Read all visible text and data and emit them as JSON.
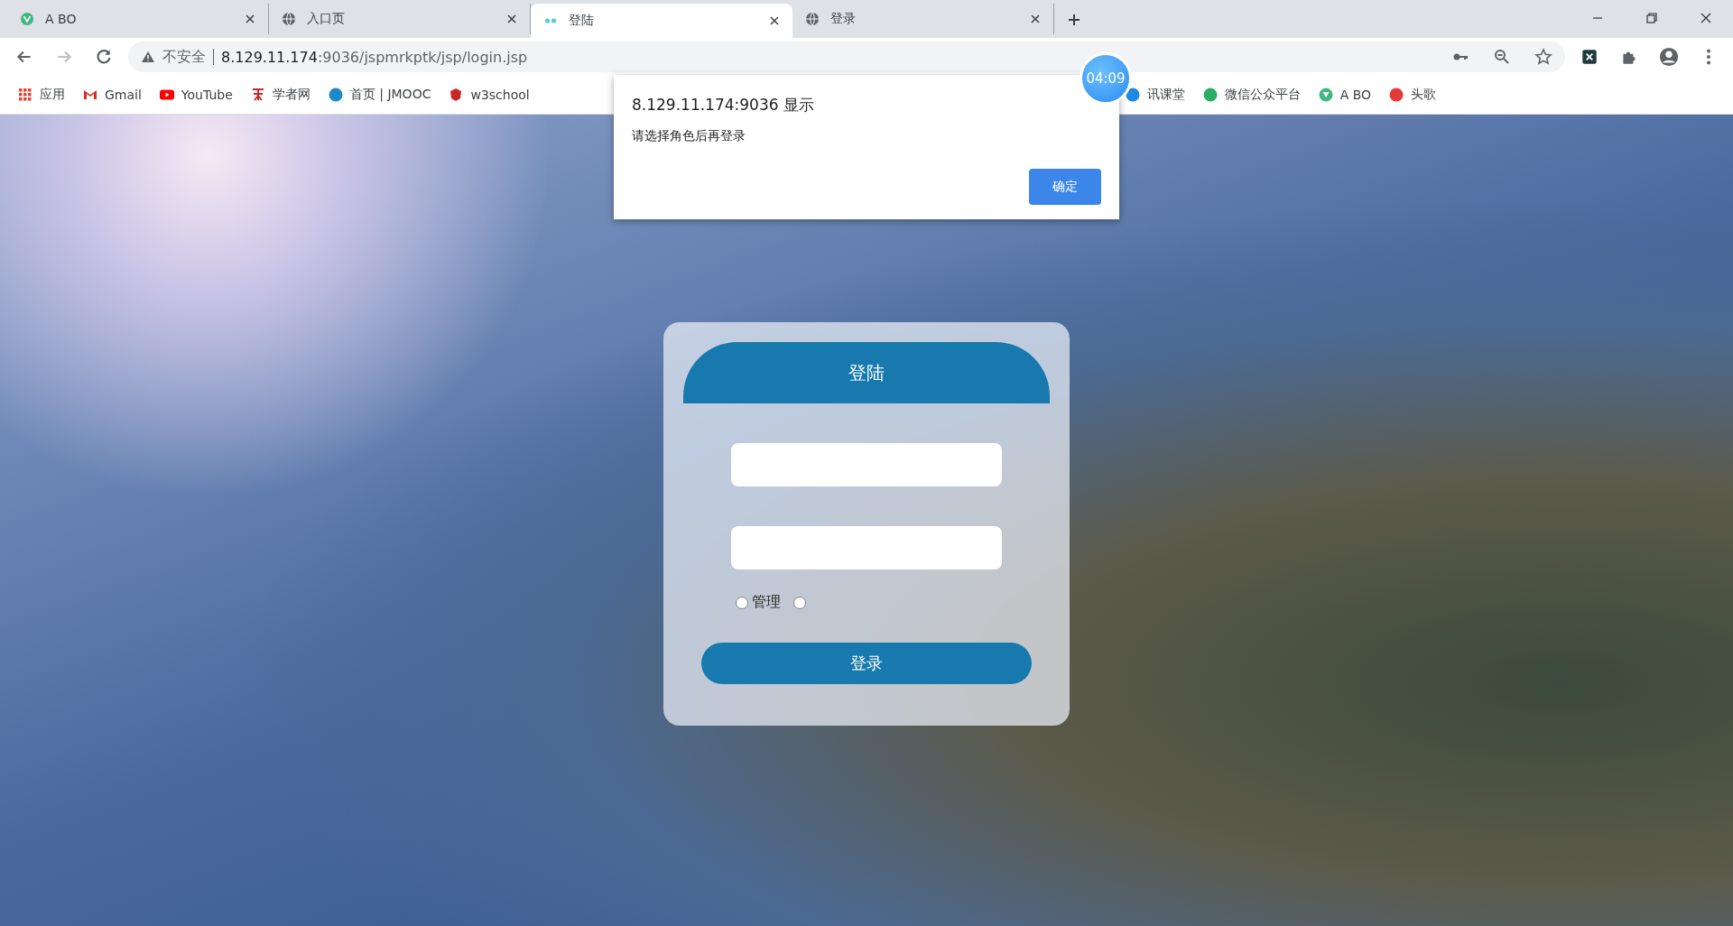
{
  "tabs": [
    {
      "title": "A BO",
      "selected": false,
      "kind": "v"
    },
    {
      "title": "入口页",
      "selected": false,
      "kind": "globe"
    },
    {
      "title": "登陆",
      "selected": true,
      "kind": "dots"
    },
    {
      "title": "登录",
      "selected": false,
      "kind": "globe"
    }
  ],
  "address_bar": {
    "security": "不安全",
    "url_host": "8.129.11.174",
    "url_rest": ":9036/jspmrkptk/jsp/login.jsp"
  },
  "bookmarks": [
    {
      "label": "应用",
      "kind": "apps",
      "color": "#e94235"
    },
    {
      "label": "Gmail",
      "kind": "mail",
      "color": "#d93025"
    },
    {
      "label": "YouTube",
      "kind": "play",
      "color": "#ff0000"
    },
    {
      "label": "学者网",
      "kind": "glyph",
      "color": "#c62828"
    },
    {
      "label": "首页 | JMOOC",
      "kind": "circle",
      "color": "#1e88c8"
    },
    {
      "label": "w3school",
      "kind": "shield",
      "color": "#c62828"
    },
    {
      "label": "讯课堂",
      "kind": "circle",
      "color": "#1e88e5"
    },
    {
      "label": "微信公众平台",
      "kind": "circle",
      "color": "#2aae67"
    },
    {
      "label": "A BO",
      "kind": "v",
      "color": "#41b883"
    },
    {
      "label": "头歌",
      "kind": "circle",
      "color": "#e53935"
    }
  ],
  "login": {
    "title": "登陆",
    "roles": [
      {
        "label": "管理",
        "selected": false
      },
      {
        "selected": false
      }
    ],
    "submit": "登录"
  },
  "dialog": {
    "title": "8.129.11.174:9036 显示",
    "message": "请选择角色后再登录",
    "ok": "确定"
  },
  "timer": "04:09"
}
